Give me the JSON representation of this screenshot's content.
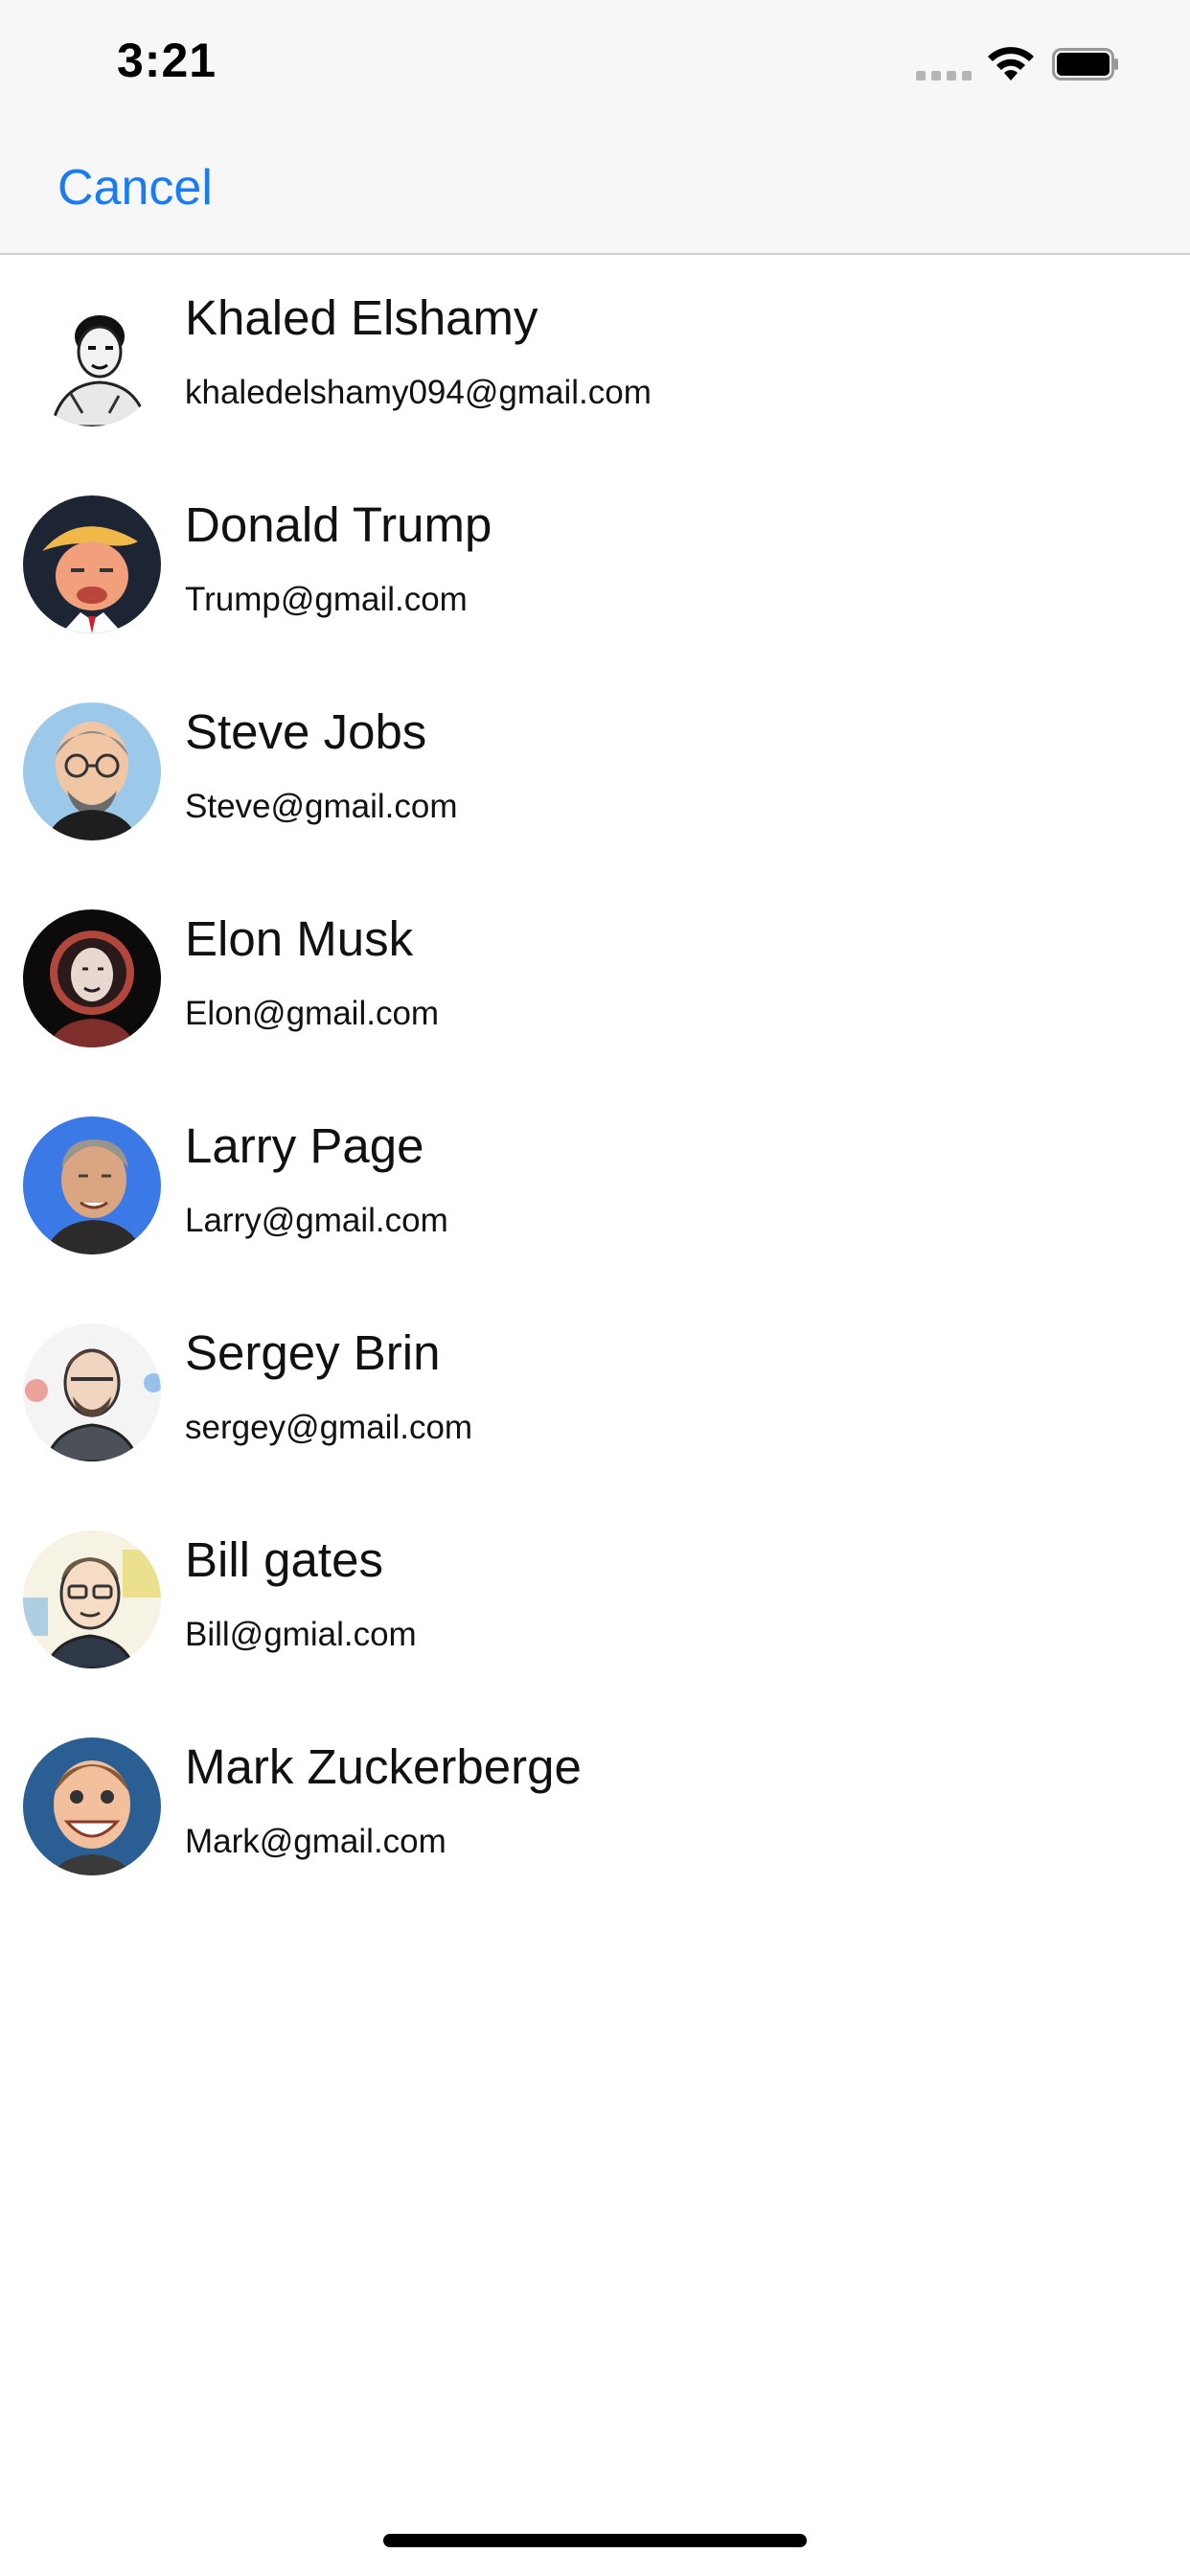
{
  "status_bar": {
    "time": "3:21",
    "icons": [
      "cellular-signal-icon",
      "wifi-icon",
      "battery-icon"
    ]
  },
  "nav": {
    "cancel_label": "Cancel",
    "accent_color": "#1a7cf2"
  },
  "contacts": [
    {
      "name": "Khaled Elshamy",
      "email": "khaledelshamy094@gmail.com",
      "avatar": "avatar-sketch"
    },
    {
      "name": "Donald Trump",
      "email": "Trump@gmail.com",
      "avatar": "avatar-caricature"
    },
    {
      "name": "Steve Jobs",
      "email": "Steve@gmail.com",
      "avatar": "avatar-caricature"
    },
    {
      "name": "Elon Musk",
      "email": "Elon@gmail.com",
      "avatar": "avatar-astronaut"
    },
    {
      "name": "Larry Page",
      "email": "Larry@gmail.com",
      "avatar": "avatar-photo"
    },
    {
      "name": "Sergey Brin",
      "email": "sergey@gmail.com",
      "avatar": "avatar-illustration"
    },
    {
      "name": "Bill gates",
      "email": "Bill@gmial.com",
      "avatar": "avatar-illustration"
    },
    {
      "name": "Mark Zuckerberge",
      "email": "Mark@gmail.com",
      "avatar": "avatar-caricature"
    }
  ]
}
